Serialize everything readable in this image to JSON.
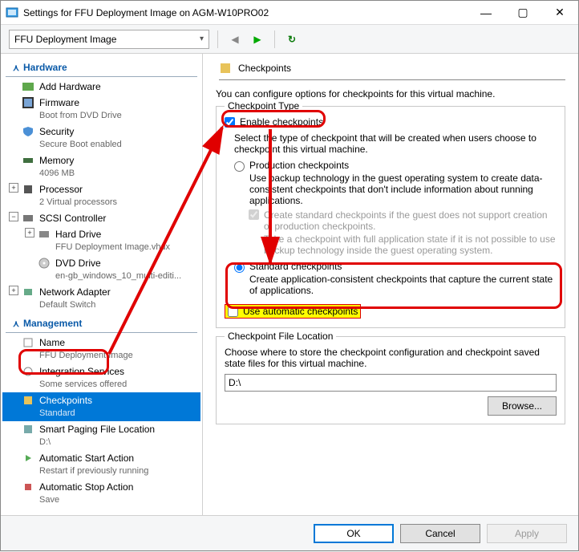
{
  "window": {
    "title": "Settings for FFU Deployment Image on AGM-W10PRO02"
  },
  "toolbar": {
    "vm_select": "FFU Deployment Image"
  },
  "sidebar": {
    "groups": [
      {
        "label": "Hardware",
        "items": [
          {
            "name": "add-hardware",
            "label": "Add Hardware",
            "sub": ""
          },
          {
            "name": "firmware",
            "label": "Firmware",
            "sub": "Boot from DVD Drive"
          },
          {
            "name": "security",
            "label": "Security",
            "sub": "Secure Boot enabled"
          },
          {
            "name": "memory",
            "label": "Memory",
            "sub": "4096 MB"
          },
          {
            "name": "processor",
            "label": "Processor",
            "sub": "2 Virtual processors",
            "exp": "+"
          },
          {
            "name": "scsi",
            "label": "SCSI Controller",
            "sub": "",
            "exp": "−",
            "children": [
              {
                "name": "hard-drive",
                "label": "Hard Drive",
                "sub": "FFU Deployment Image.vhdx",
                "exp": "+"
              },
              {
                "name": "dvd-drive",
                "label": "DVD Drive",
                "sub": "en-gb_windows_10_multi-editi..."
              }
            ]
          },
          {
            "name": "network-adapter",
            "label": "Network Adapter",
            "sub": "Default Switch",
            "exp": "+"
          }
        ]
      },
      {
        "label": "Management",
        "items": [
          {
            "name": "name",
            "label": "Name",
            "sub": "FFU Deployment Image"
          },
          {
            "name": "integration-services",
            "label": "Integration Services",
            "sub": "Some services offered"
          },
          {
            "name": "checkpoints",
            "label": "Checkpoints",
            "sub": "Standard",
            "selected": true
          },
          {
            "name": "smart-paging",
            "label": "Smart Paging File Location",
            "sub": "D:\\"
          },
          {
            "name": "auto-start",
            "label": "Automatic Start Action",
            "sub": "Restart if previously running"
          },
          {
            "name": "auto-stop",
            "label": "Automatic Stop Action",
            "sub": "Save"
          }
        ]
      }
    ]
  },
  "pane": {
    "title": "Checkpoints",
    "intro": "You can configure options for checkpoints for this virtual machine.",
    "type_legend": "Checkpoint Type",
    "enable_label": "Enable checkpoints",
    "select_desc": "Select the type of checkpoint that will be created when users choose to checkpoint this virtual machine.",
    "prod_label": "Production checkpoints",
    "prod_desc": "Use backup technology in the guest operating system to create data-consistent checkpoints that don't include information about running applications.",
    "prod_std_label": "Create standard checkpoints if the guest does not support creation of production checkpoints.",
    "prod_std_sub": "Take a checkpoint with full application state if it is not possible to use backup technology inside the guest operating system.",
    "std_label": "Standard checkpoints",
    "std_desc": "Create application-consistent checkpoints that capture the current state of applications.",
    "auto_label": "Use automatic checkpoints",
    "loc_legend": "Checkpoint File Location",
    "loc_desc": "Choose where to store the checkpoint configuration and checkpoint saved state files for this virtual machine.",
    "loc_value": "D:\\",
    "browse": "Browse...",
    "ok": "OK",
    "cancel": "Cancel",
    "apply": "Apply"
  }
}
